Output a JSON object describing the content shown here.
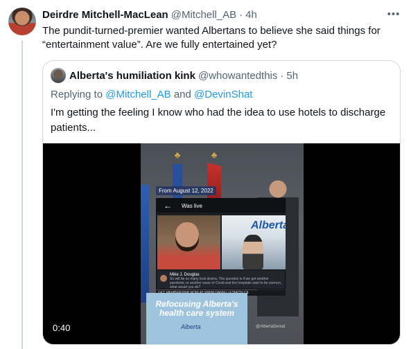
{
  "tweet": {
    "author_name": "Deirdre Mitchell-MacLean",
    "author_handle": "@Mitchell_AB",
    "separator": "·",
    "time": "4h",
    "more_icon": "more-horizontal-icon",
    "text": "The pundit-turned-premier wanted Albertans to believe she said things for “entertainment value”. Are we fully entertained yet?"
  },
  "quote": {
    "author_name": "Alberta's humiliation kink",
    "author_handle": "@whowantedthis",
    "separator": "·",
    "time": "5h",
    "replying_prefix": "Replying to ",
    "reply_user_1": "@Mitchell_AB",
    "reply_and": " and ",
    "reply_user_2": "@DevinShat",
    "text": "I'm getting the feeling I know who had the idea to use hotels to discharge patients..."
  },
  "video": {
    "date_chip": "From August 12, 2022",
    "live_label": "Was live",
    "back_icon": "arrow-left-icon",
    "brand_text": "Alberta",
    "comment_author": "Mike J. Douglas",
    "comment_text": "So will be so many look drama. The question is if we get another pandemic or another wave of Covid and the hospitals start to be overrun, what would you do?",
    "tagline": "GET MEMBERSHIP NOW AT WWW.DANIELLESMITH.CA",
    "podium_text": "Refocusing Alberta's health care system",
    "podium_signature": "Alberta",
    "watermark": "@AlbertaDenial",
    "duration": "0:40"
  }
}
